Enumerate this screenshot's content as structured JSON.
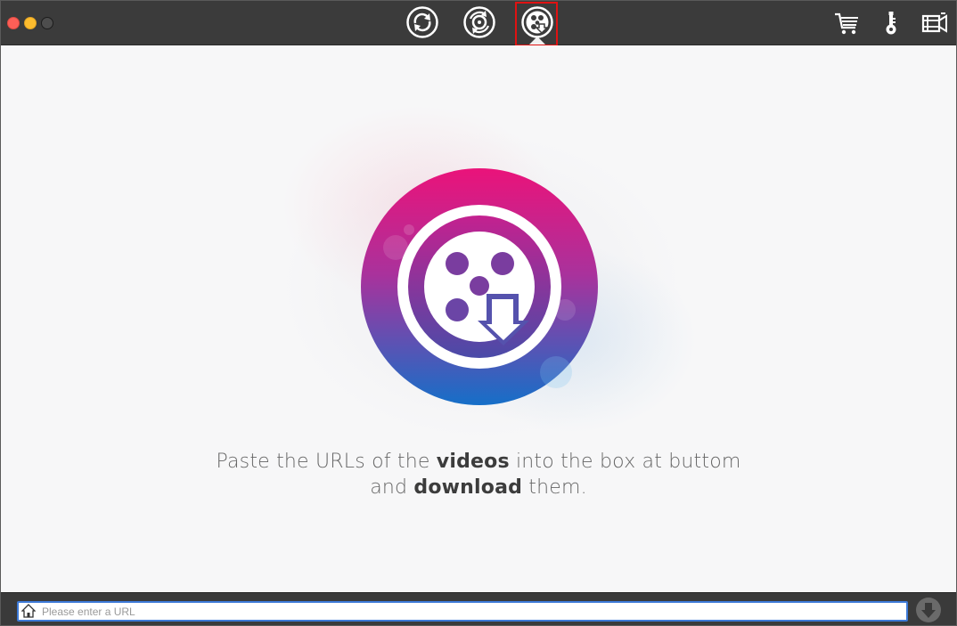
{
  "window": {
    "traffic_lights": [
      "close",
      "minimize",
      "zoom"
    ]
  },
  "toolbar": {
    "modes": [
      {
        "icon": "convert-icon",
        "active": false
      },
      {
        "icon": "burn-dvd-icon",
        "active": false
      },
      {
        "icon": "video-download-icon",
        "active": true
      }
    ],
    "right_icons": [
      "cart-icon",
      "key-icon",
      "video-toolbox-icon"
    ]
  },
  "main": {
    "logo_icon": "video-download-logo-icon",
    "message_part1": "Paste the URLs of the ",
    "message_bold1": "videos",
    "message_part2": " into the box at buttom",
    "message_part3": "and ",
    "message_bold2": "download",
    "message_part4": " them."
  },
  "bottom_bar": {
    "home_icon": "home-icon",
    "url_placeholder": "Please enter a URL",
    "url_value": "",
    "download_icon": "download-arrow-icon"
  },
  "colors": {
    "titlebar": "#3b3b3b",
    "active_highlight": "#e01212",
    "logo_gradient_top": "#e8157a",
    "logo_gradient_bottom": "#1b6fc6",
    "input_border": "#3d7ad8"
  }
}
